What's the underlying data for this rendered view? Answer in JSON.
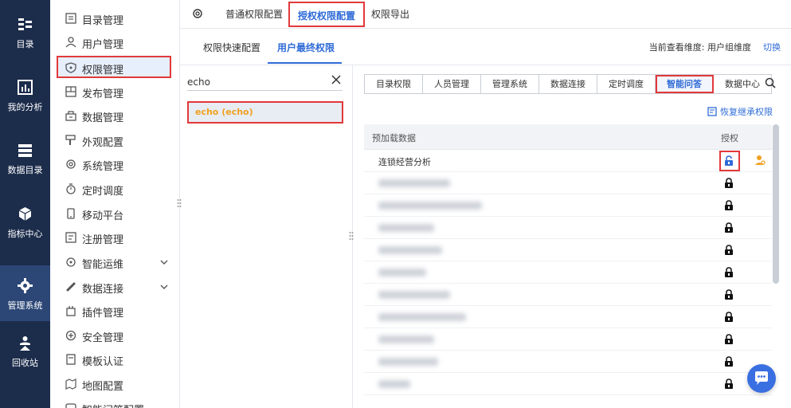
{
  "rail": [
    {
      "label": "目录",
      "icon": "catalog-icon"
    },
    {
      "label": "我的分析",
      "icon": "bar-chart-icon"
    },
    {
      "label": "数据目录",
      "icon": "database-icon"
    },
    {
      "label": "指标中心",
      "icon": "cubes-icon"
    },
    {
      "label": "管理系统",
      "icon": "gear-cog-icon",
      "active": true
    },
    {
      "label": "回收站",
      "icon": "recycle-icon"
    }
  ],
  "sidebar": {
    "items": [
      {
        "label": "目录管理",
        "icon": "list-icon"
      },
      {
        "label": "用户管理",
        "icon": "user-icon"
      },
      {
        "label": "权限管理",
        "icon": "shield-icon",
        "active": true
      },
      {
        "label": "发布管理",
        "icon": "publish-icon"
      },
      {
        "label": "数据管理",
        "icon": "data-icon"
      },
      {
        "label": "外观配置",
        "icon": "brush-icon"
      },
      {
        "label": "系统管理",
        "icon": "settings-icon"
      },
      {
        "label": "定时调度",
        "icon": "clock-icon"
      },
      {
        "label": "移动平台",
        "icon": "mobile-icon"
      },
      {
        "label": "注册管理",
        "icon": "register-icon"
      },
      {
        "label": "智能运维",
        "icon": "ops-icon",
        "expandable": true
      },
      {
        "label": "数据连接",
        "icon": "link-icon",
        "expandable": true
      },
      {
        "label": "插件管理",
        "icon": "plugin-icon"
      },
      {
        "label": "安全管理",
        "icon": "security-icon"
      },
      {
        "label": "模板认证",
        "icon": "template-icon"
      },
      {
        "label": "地图配置",
        "icon": "map-icon"
      },
      {
        "label": "智能问答配置",
        "icon": "qa-icon"
      }
    ]
  },
  "topbar": {
    "tabs": [
      "普通权限配置",
      "授权权限配置",
      "权限导出"
    ],
    "active_index": 1
  },
  "subbar": {
    "tabs": [
      "权限快速配置",
      "用户最终权限"
    ],
    "active_index": 1,
    "dimension_label": "当前查看维度:  用户组维度",
    "switch_label": "切换"
  },
  "userpanel": {
    "search_value": "echo",
    "user": {
      "name": "echo",
      "sub": "(echo)"
    }
  },
  "permissions": {
    "categories": [
      "目录权限",
      "人员管理",
      "管理系统",
      "数据连接",
      "定时调度",
      "智能问答",
      "数据中心"
    ],
    "active_category": 5,
    "restore_label": "恢复继承权限",
    "column_name": "预加载数据",
    "column_auth": "授权",
    "first_row": "连锁经营分析",
    "blurred_row_count": 10,
    "colors": {
      "accent": "#2f6bd7",
      "highlight": "#e2393a",
      "user_color": "#f0a020"
    }
  }
}
